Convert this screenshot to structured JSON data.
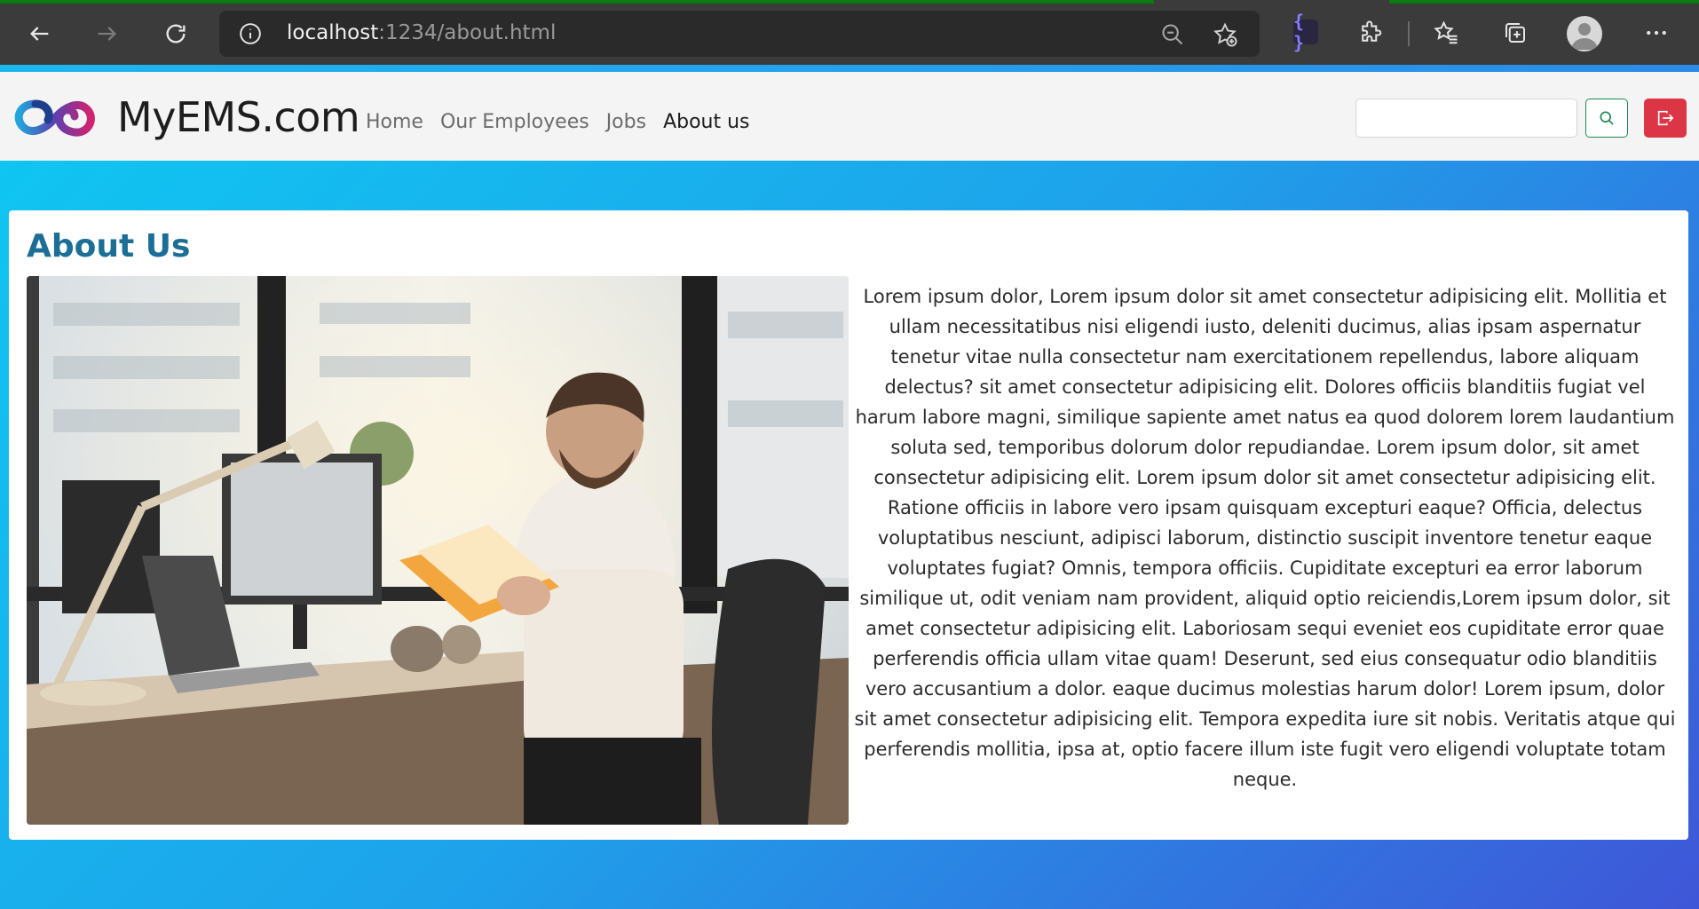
{
  "browser": {
    "url_host": "localhost",
    "url_path": ":1234/about.html",
    "buttons": {
      "back": "back-icon",
      "forward": "forward-icon",
      "reload": "reload-icon"
    },
    "extension_badge": "{ }"
  },
  "navbar": {
    "brand": "MyEMS.com",
    "links": [
      {
        "label": "Home"
      },
      {
        "label": "Our Employees"
      },
      {
        "label": "Jobs"
      },
      {
        "label": "About us"
      }
    ],
    "active_link": "About us",
    "search_placeholder": ""
  },
  "main": {
    "heading": "About Us",
    "paragraph": "Lorem ipsum dolor, Lorem ipsum dolor sit amet consectetur adipisicing elit. Mollitia et ullam necessitatibus nisi eligendi iusto, deleniti ducimus, alias ipsam aspernatur tenetur vitae nulla consectetur nam exercitationem repellendus, labore aliquam delectus? sit amet consectetur adipisicing elit. Dolores officiis blanditiis fugiat vel harum labore magni, similique sapiente amet natus ea quod dolorem lorem laudantium soluta sed, temporibus dolorum dolor repudiandae. Lorem ipsum dolor, sit amet consectetur adipisicing elit. Lorem ipsum dolor sit amet consectetur adipisicing elit. Ratione officiis in labore vero ipsam quisquam excepturi eaque? Officia, delectus voluptatibus nesciunt, adipisci laborum, distinctio suscipit inventore tenetur eaque voluptates fugiat? Omnis, tempora officiis. Cupiditate excepturi ea error laborum similique ut, odit veniam nam provident, aliquid optio reiciendis,Lorem ipsum dolor, sit amet consectetur adipisicing elit. Laboriosam sequi eveniet eos cupiditate error quae perferendis officia ullam vitae quam! Deserunt, sed eius consequatur odio blanditiis vero accusantium a dolor. eaque ducimus molestias harum dolor! Lorem ipsum, dolor sit amet consectetur adipisicing elit. Tempora expedita iure sit nobis. Veritatis atque qui perferendis mollitia, ipsa at, optio facere illum iste fugit vero eligendi voluptate totam neque."
  },
  "colors": {
    "heading": "#1b6e95",
    "search_button": "#198754",
    "logout_button": "#dc3545",
    "gradient_start": "#0fc8f2",
    "gradient_end": "#3f56d8"
  }
}
